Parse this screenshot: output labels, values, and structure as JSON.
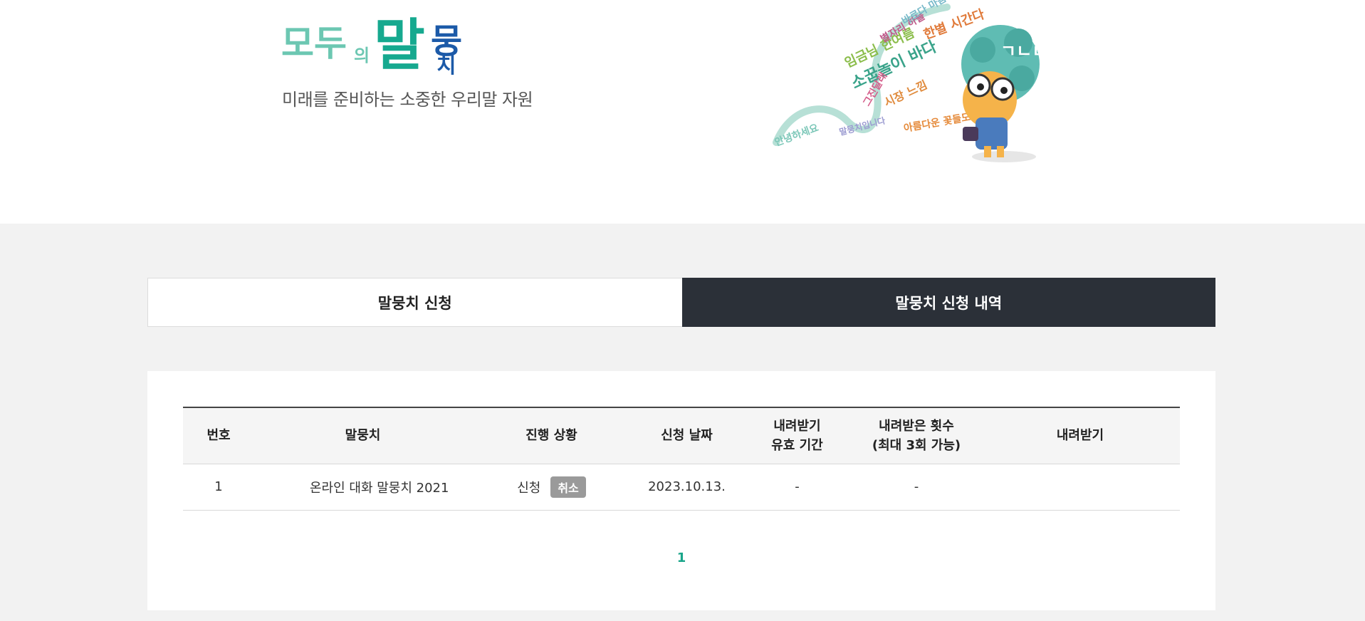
{
  "header": {
    "logo_text": "모두의 말뭉치",
    "slogan": "미래를 준비하는 소중한 우리말 자원"
  },
  "tabs": [
    {
      "label": "말뭉치 신청",
      "active": false
    },
    {
      "label": "말뭉치 신청 내역",
      "active": true
    }
  ],
  "table": {
    "headers": {
      "no": "번호",
      "corpus": "말뭉치",
      "status": "진행 상황",
      "date": "신청 날짜",
      "valid_line1": "내려받기",
      "valid_line2": "유효 기간",
      "count_line1": "내려받은 횟수",
      "count_line2": "(최대 3회 가능)",
      "download": "내려받기"
    },
    "rows": [
      {
        "no": "1",
        "corpus": "온라인 대화 말뭉치 2021",
        "status": "신청",
        "cancel": "취소",
        "date": "2023.10.13.",
        "valid": "-",
        "count": "-",
        "download": ""
      }
    ]
  },
  "pagination": {
    "current": "1"
  },
  "colors": {
    "active_tab": "#2b3038",
    "page_accent": "#1aa58a",
    "cancel_badge": "#9a9a9a",
    "section_bg": "#f2f2f2"
  }
}
